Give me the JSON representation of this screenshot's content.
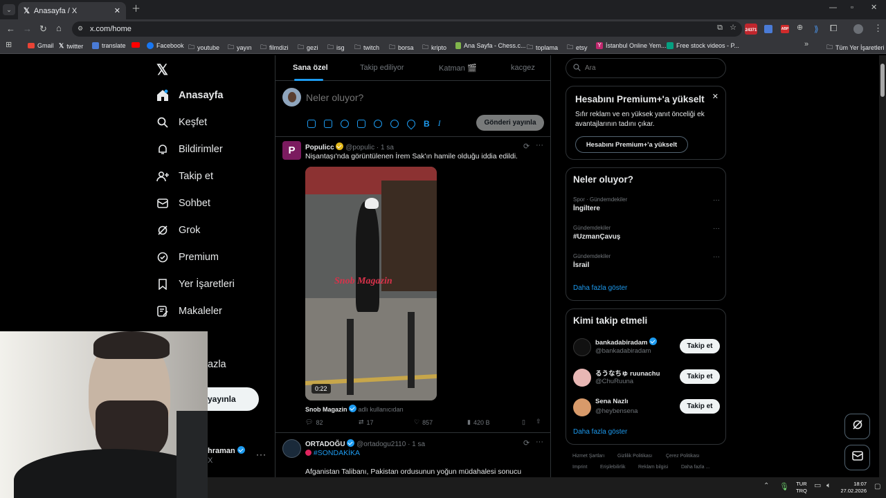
{
  "browser": {
    "tab_title": "Anasayfa / X",
    "url": "x.com/home",
    "bookmarks": [
      "Gmail",
      "twitter",
      "translate",
      "Facebook",
      "youtube",
      "yayın",
      "filmdizi",
      "gezi",
      "isg",
      "twitch",
      "borsa",
      "kripto",
      "Ana Sayfa - Chess.c...",
      "toplama",
      "etsy",
      "İstanbul Online Yem...",
      "Free stock videos - P..."
    ],
    "all_bookmarks": "Tüm Yer İşaretleri",
    "ext_badge": "24371"
  },
  "nav": {
    "items": [
      "Anasayfa",
      "Keşfet",
      "Bildirimler",
      "Takip et",
      "Sohbet",
      "Grok",
      "Premium",
      "Yer İşaretleri",
      "Makaleler"
    ],
    "more": "azla",
    "post_button": "yayınla",
    "account_name": "hraman",
    "account_sub": "X"
  },
  "timeline": {
    "tabs": [
      "Sana özel",
      "Takip ediliyor",
      "Katman 🎬",
      "kacgez"
    ],
    "compose_placeholder": "Neler oluyor?",
    "post_button": "Gönderi yayınla",
    "posts": [
      {
        "name": "Populicc",
        "handle": "@populic",
        "time": "· 1 sa",
        "text": "Nişantaşı'nda görüntülenen İrem Sak'ın hamile olduğu iddia edildi.",
        "video_duration": "0:22",
        "video_watermark": "Snob Magazin",
        "credit_name": "Snob Magazin",
        "credit_sub": "adlı kullanıcıdan",
        "replies": "82",
        "reposts": "17",
        "likes": "857",
        "views": "420 B"
      },
      {
        "name": "ORTADOĞU",
        "handle": "@ortadogu2110",
        "time": "· 1 sa",
        "hashtag": "#SONDAKİKA",
        "text": "Afganistan Talibanı, Pakistan ordusunun yoğun müdahalesi sonucu"
      }
    ]
  },
  "sidebar": {
    "search_placeholder": "Ara",
    "premium": {
      "title": "Hesabını Premium+'a yükselt",
      "desc": "Sıfır reklam ve en yüksek yanıt önceliği ek avantajlarının tadını çıkar.",
      "button": "Hesabını Premium+'a yükselt"
    },
    "trends": {
      "title": "Neler oluyor?",
      "items": [
        {
          "sub": "Spor · Gündemdekiler",
          "title": "İngiltere"
        },
        {
          "sub": "Gündemdekiler",
          "title": "#UzmanÇavuş"
        },
        {
          "sub": "Gündemdekiler",
          "title": "İsrail"
        }
      ],
      "more": "Daha fazla göster"
    },
    "who_to_follow": {
      "title": "Kimi takip etmeli",
      "users": [
        {
          "name": "bankadabiradam",
          "handle": "@bankadabiradam",
          "button": "Takip et"
        },
        {
          "name": "るうなちゅ ruunachu",
          "handle": "@ChuRuuna",
          "button": "Takip et"
        },
        {
          "name": "Sena Nazlı",
          "handle": "@heybensena",
          "button": "Takip et"
        }
      ],
      "more": "Daha fazla göster"
    },
    "footer": [
      "Hizmet Şartları",
      "Gizlilik Politikası",
      "Çerez Politikası",
      "Imprint",
      "Erişilebilirlik",
      "Reklam bilgisi",
      "Daha fazla ..."
    ]
  },
  "taskbar": {
    "lang": "TUR",
    "lang2": "TRQ",
    "time": "18:07",
    "date": "27.02.2026"
  },
  "colors": {
    "accent": "#1d9bf0",
    "background": "#000000",
    "border": "#2f3336"
  }
}
